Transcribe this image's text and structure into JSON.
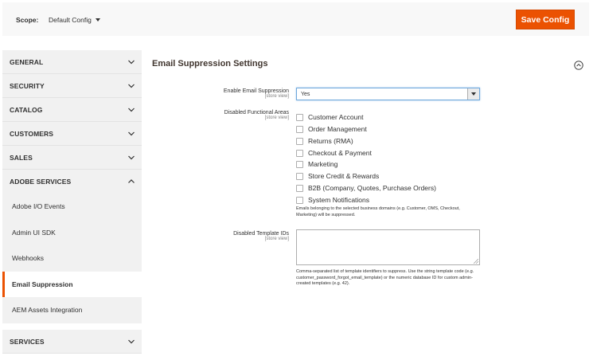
{
  "scope": {
    "label": "Scope:",
    "selected": "Default Config"
  },
  "toolbar": {
    "save_label": "Save Config"
  },
  "sidebar": {
    "sections": [
      {
        "label": "GENERAL"
      },
      {
        "label": "SECURITY"
      },
      {
        "label": "CATALOG"
      },
      {
        "label": "CUSTOMERS"
      },
      {
        "label": "SALES"
      },
      {
        "label": "ADOBE SERVICES"
      }
    ],
    "sub_items": [
      {
        "label": "Adobe I/O Events"
      },
      {
        "label": "Admin UI SDK"
      },
      {
        "label": "Webhooks"
      },
      {
        "label": "Email Suppression"
      },
      {
        "label": "AEM Assets Integration"
      }
    ],
    "active_item": "Email Suppression",
    "last_section": {
      "label": "SERVICES"
    }
  },
  "main": {
    "title": "Email Suppression Settings",
    "enable": {
      "label": "Enable Email Suppression",
      "scope": "[store view]",
      "value": "Yes"
    },
    "areas": {
      "label": "Disabled Functional Areas",
      "scope": "[store view]",
      "options": [
        "Customer Account",
        "Order Management",
        "Returns (RMA)",
        "Checkout & Payment",
        "Marketing",
        "Store Credit & Rewards",
        "B2B (Company, Quotes, Purchase Orders)",
        "System Notifications"
      ],
      "note": "Emails belonging to the selected business domains (e.g. Customer, OMS, Checkout, Marketing) will be suppressed."
    },
    "templates": {
      "label": "Disabled Template IDs",
      "scope": "[store view]",
      "value": "",
      "note": "Comma-separated list of template identifiers to suppress. Use the string template code (e.g. customer_password_forgot_email_template) or the numeric database ID for custom admin-created templates (e.g. 42)."
    }
  },
  "colors": {
    "accent": "#eb5202",
    "sidebar_bg": "#f1f1f1",
    "text": "#303030"
  },
  "icons": {
    "section_chevron": "chevron-down-icon",
    "expanded_chevron": "chevron-up-icon",
    "collapse": "collapse-circle-icon",
    "scope_caret": "caret-down-icon"
  }
}
